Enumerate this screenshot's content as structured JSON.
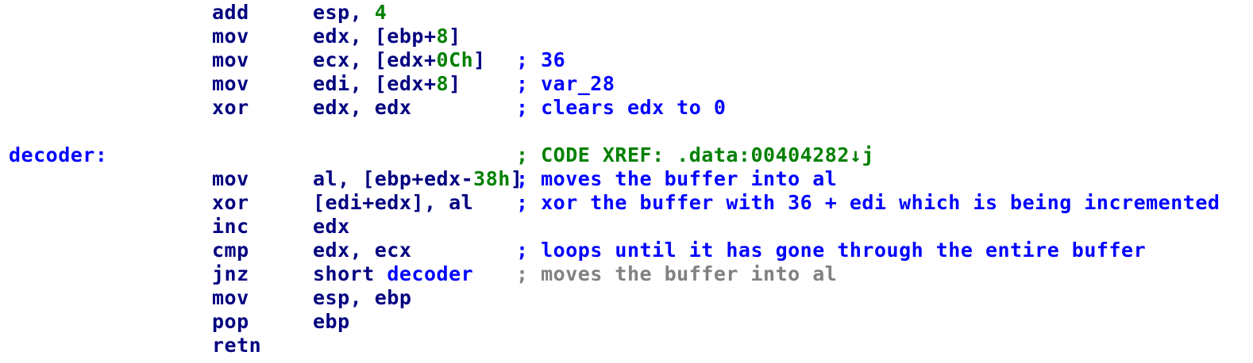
{
  "colors": {
    "mnemonic": "#000080",
    "label": "#0000ff",
    "comment": "#0000ff",
    "xref_comment": "#008000",
    "immediate": "#008000",
    "repeat_comment": "#808080",
    "background": "#ffffff"
  },
  "lines": [
    {
      "mnemonic": "add",
      "operands": [
        {
          "t": "esp, "
        },
        {
          "t": "4",
          "k": "num"
        }
      ],
      "comment": ""
    },
    {
      "mnemonic": "mov",
      "operands": [
        {
          "t": "edx, [ebp+"
        },
        {
          "t": "8",
          "k": "num"
        },
        {
          "t": "]"
        }
      ],
      "comment": ""
    },
    {
      "mnemonic": "mov",
      "operands": [
        {
          "t": "ecx, [edx+"
        },
        {
          "t": "0Ch",
          "k": "num"
        },
        {
          "t": "]"
        }
      ],
      "comment": "; 36"
    },
    {
      "mnemonic": "mov",
      "operands": [
        {
          "t": "edi, [edx+"
        },
        {
          "t": "8",
          "k": "num"
        },
        {
          "t": "]"
        }
      ],
      "comment": "; var_28"
    },
    {
      "mnemonic": "xor",
      "operands": [
        {
          "t": "edx, edx"
        }
      ],
      "comment": "; clears edx to 0"
    },
    {
      "blank": true
    },
    {
      "label": "decoder:",
      "comment": "; CODE XREF: .data:00404282",
      "comment_suffix": "j",
      "comment_style": "xref",
      "xref_icon": "down-arrow-icon",
      "xref_glyph": "↓"
    },
    {
      "mnemonic": "mov",
      "operands": [
        {
          "t": "al, [ebp+edx-"
        },
        {
          "t": "38h",
          "k": "num"
        },
        {
          "t": "]"
        }
      ],
      "comment": "; moves the buffer into al"
    },
    {
      "mnemonic": "xor",
      "operands": [
        {
          "t": "[edi+edx], al"
        }
      ],
      "comment": "; xor the buffer with 36 + edi which is being incremented"
    },
    {
      "mnemonic": "inc",
      "operands": [
        {
          "t": "edx"
        }
      ],
      "comment": ""
    },
    {
      "mnemonic": "cmp",
      "operands": [
        {
          "t": "edx, ecx"
        }
      ],
      "comment": "; loops until it has gone through the entire buffer"
    },
    {
      "mnemonic": "jnz",
      "operands": [
        {
          "t": "short "
        },
        {
          "t": "decoder",
          "k": "ref"
        }
      ],
      "comment": "; moves the buffer into al",
      "comment_style": "grey"
    },
    {
      "mnemonic": "mov",
      "operands": [
        {
          "t": "esp, ebp"
        }
      ],
      "comment": ""
    },
    {
      "mnemonic": "pop",
      "operands": [
        {
          "t": "ebp"
        }
      ],
      "comment": ""
    },
    {
      "mnemonic": "retn",
      "operands": [],
      "comment": ""
    }
  ]
}
